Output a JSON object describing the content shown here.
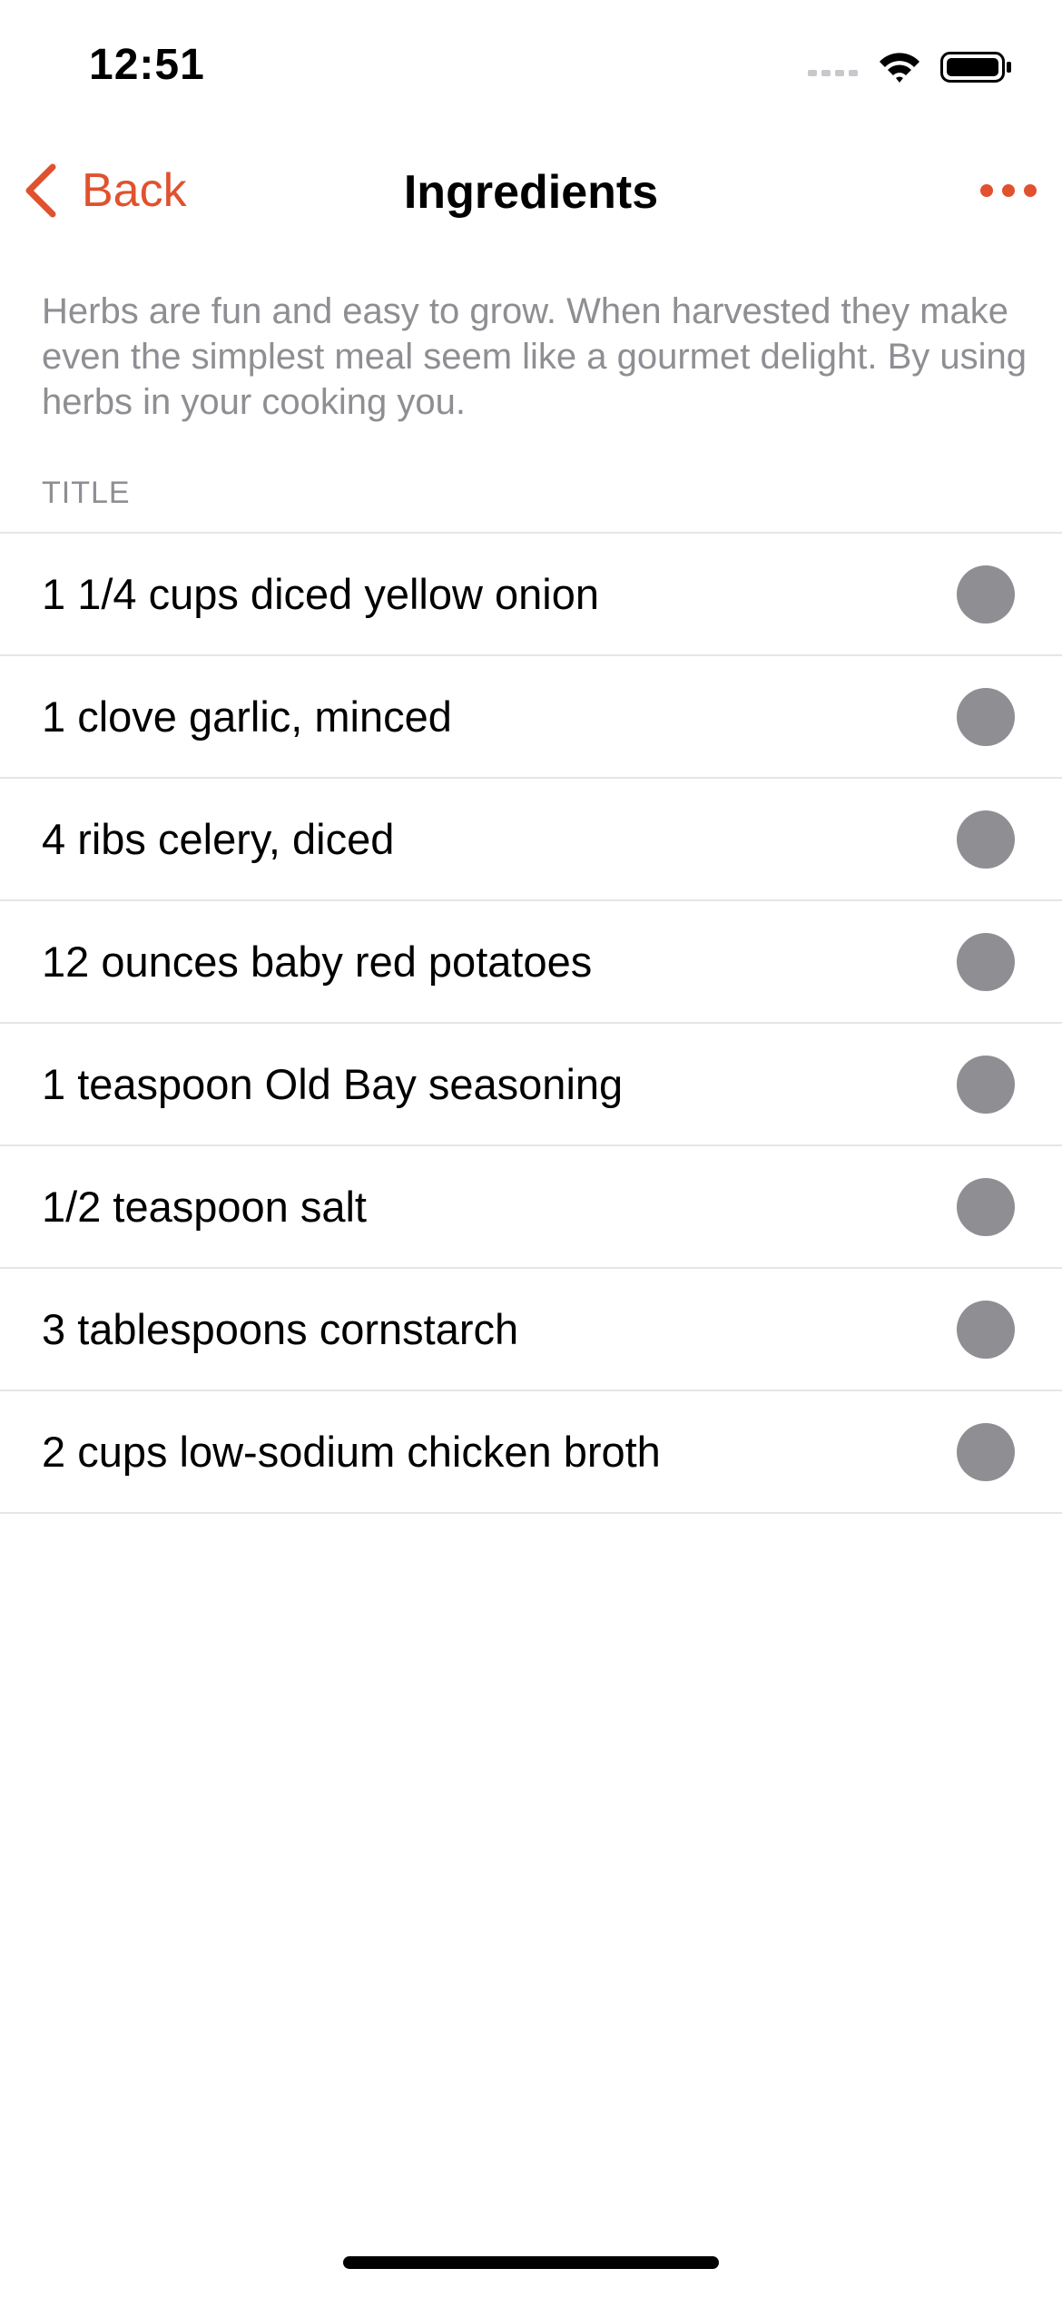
{
  "status_bar": {
    "time": "12:51",
    "icons": [
      "cellular-signal-icon",
      "wifi-icon",
      "battery-icon"
    ]
  },
  "nav": {
    "back_label": "Back",
    "back_icon": "chevron-left-icon",
    "title": "Ingredients",
    "more_icon": "ellipsis-icon"
  },
  "description": "Herbs are fun and easy to grow. When harvested they make even the simplest meal seem like a gourmet delight. By using herbs in your cooking you.",
  "section_header": "TITLE",
  "ingredients": [
    {
      "label": "1 1/4 cups diced yellow onion"
    },
    {
      "label": "1 clove garlic, minced"
    },
    {
      "label": "4 ribs celery, diced"
    },
    {
      "label": "12 ounces baby red potatoes"
    },
    {
      "label": "1 teaspoon Old Bay seasoning"
    },
    {
      "label": "1/2 teaspoon salt"
    },
    {
      "label": "3 tablespoons cornstarch"
    },
    {
      "label": "2 cups low-sodium chicken broth"
    }
  ],
  "colors": {
    "accent": "#E0522F",
    "secondary_text": "#8E8E93",
    "separator": "#E5E5EA",
    "toggle": "#8E8E93"
  }
}
